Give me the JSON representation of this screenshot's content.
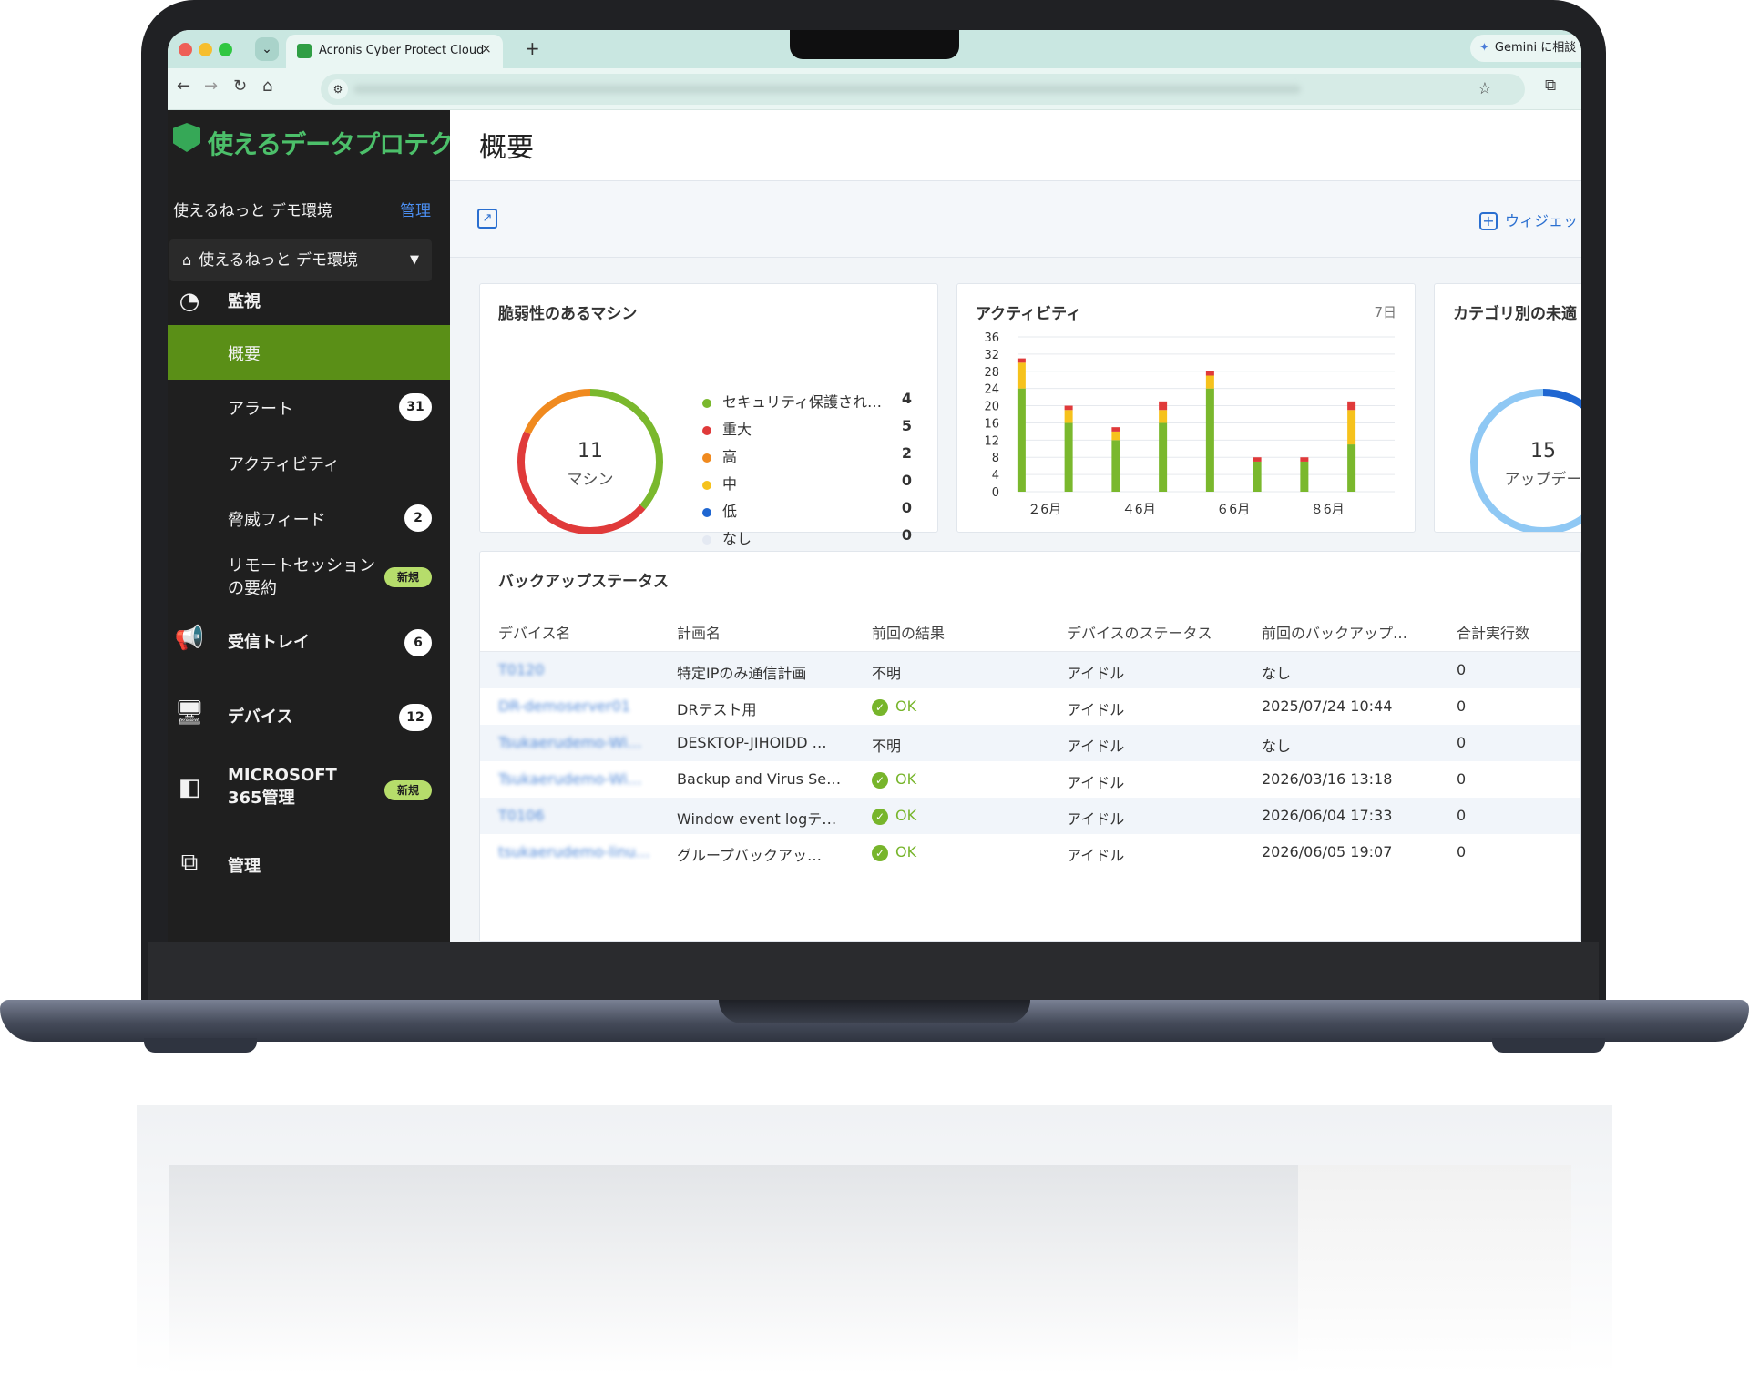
{
  "browser": {
    "tab_title": "Acronis Cyber Protect Cloud",
    "new_tab": "+",
    "close": "×",
    "gemini": "Gemini に相談"
  },
  "sidebar": {
    "logo": "使えるデータプロテクト",
    "tenant": "使えるねっと デモ環境",
    "admin": "管理",
    "tenant_selector": "使えるねっと デモ環境",
    "sections": {
      "monitor": "監視",
      "inbox": "受信トレイ",
      "devices": "デバイス",
      "m365": "MICROSOFT 365管理",
      "manage": "管理"
    },
    "items": {
      "overview": "概要",
      "alerts": "アラート",
      "activity": "アクティビティ",
      "threat_feed": "脅威フィード",
      "remote_session": "リモートセッションの要約"
    },
    "counts": {
      "alerts": "31",
      "threat_feed": "2",
      "inbox": "6",
      "devices": "12"
    },
    "new_badge": "新規"
  },
  "page": {
    "title": "概要",
    "add_widget": "ウィジェット"
  },
  "vuln": {
    "title": "脆弱性のあるマシン",
    "total": "11",
    "unit": "マシン",
    "legend": [
      {
        "label": "セキュリティ保護され…",
        "value": "4",
        "color": "#7ab82d"
      },
      {
        "label": "重大",
        "value": "5",
        "color": "#e03a3a"
      },
      {
        "label": "高",
        "value": "2",
        "color": "#f08a1f"
      },
      {
        "label": "中",
        "value": "0",
        "color": "#f6c21c"
      },
      {
        "label": "低",
        "value": "0",
        "color": "#1f66d1"
      },
      {
        "label": "なし",
        "value": "0",
        "color": "#e4e9f2"
      }
    ]
  },
  "activity": {
    "title": "アクティビティ",
    "period": "7日",
    "chart_data": {
      "type": "bar",
      "ylim": [
        0,
        36
      ],
      "yticks": [
        0,
        4,
        8,
        12,
        16,
        20,
        24,
        28,
        32,
        36
      ],
      "xtick_labels": [
        "２6月",
        "４6月",
        "６6月",
        "８6月"
      ],
      "series": [
        {
          "name": "green",
          "color": "#7ab82d",
          "values": [
            24,
            16,
            12,
            16,
            24,
            7,
            7,
            11
          ]
        },
        {
          "name": "yellow",
          "color": "#f6c21c",
          "values": [
            6,
            3,
            2,
            3,
            3,
            0,
            0,
            8
          ]
        },
        {
          "name": "red",
          "color": "#e03a3a",
          "values": [
            1,
            1,
            1,
            2,
            1,
            1,
            1,
            2
          ]
        }
      ]
    }
  },
  "category": {
    "title": "カテゴリ別の未適",
    "total": "15",
    "unit": "アップデー"
  },
  "backup": {
    "title": "バックアップステータス",
    "headers": [
      "デバイス名",
      "計画名",
      "前回の結果",
      "デバイスのステータス",
      "前回のバックアップ…",
      "合計実行数"
    ],
    "rows": [
      {
        "device": "T0120",
        "plan": "特定IPのみ通信計画",
        "result": "不明",
        "ok": false,
        "status": "アイドル",
        "last": "なし",
        "runs": "0"
      },
      {
        "device": "DR-demoserver01",
        "plan": "DRテスト用",
        "result": "OK",
        "ok": true,
        "status": "アイドル",
        "last": "2025/07/24 10:44",
        "runs": "0"
      },
      {
        "device": "Tsukaerudemo-Wi…",
        "plan": "DESKTOP-JIHOIDD …",
        "result": "不明",
        "ok": false,
        "status": "アイドル",
        "last": "なし",
        "runs": "0"
      },
      {
        "device": "Tsukaerudemo-Wi…",
        "plan": "Backup and Virus Se…",
        "result": "OK",
        "ok": true,
        "status": "アイドル",
        "last": "2026/03/16 13:18",
        "runs": "0"
      },
      {
        "device": "T0106",
        "plan": "Window event logテ…",
        "result": "OK",
        "ok": true,
        "status": "アイドル",
        "last": "2026/06/04 17:33",
        "runs": "0"
      },
      {
        "device": "tsukaerudemo-linu…",
        "plan": "グループバックアッ…",
        "result": "OK",
        "ok": true,
        "status": "アイドル",
        "last": "2026/06/05 19:07",
        "runs": "0"
      }
    ]
  }
}
